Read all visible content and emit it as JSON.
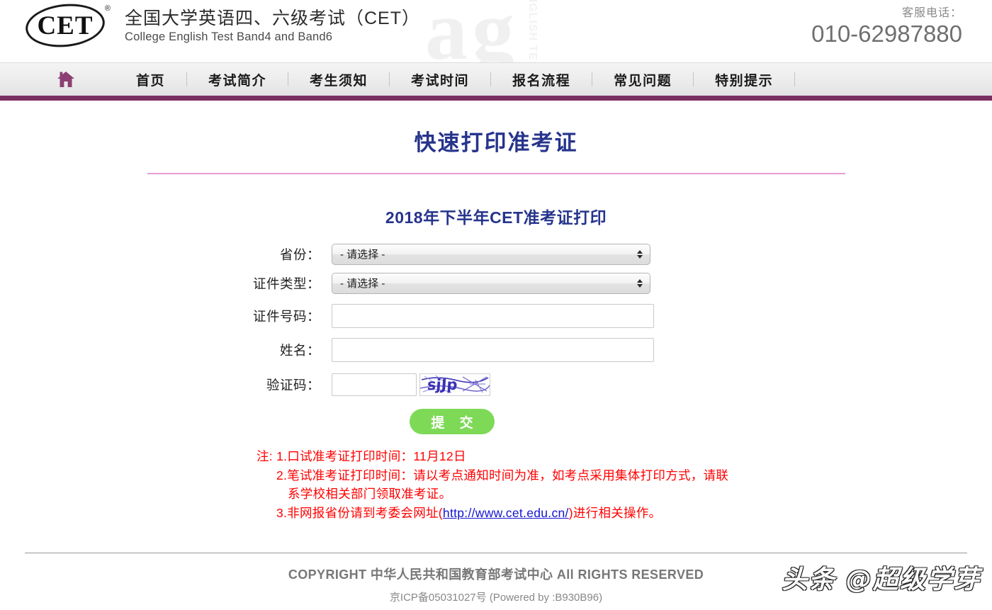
{
  "header": {
    "logo_text": "CET",
    "logo_reg": "®",
    "title_cn": "全国大学英语四、六级考试（CET）",
    "title_en": "College English Test Band4 and Band6",
    "service_label": "客服电话：",
    "service_phone": "010-62987880",
    "background_watermark": "ag",
    "background_watermark_rot": "ENGLISH TEST"
  },
  "nav": {
    "home_icon": "home-icon",
    "items": [
      {
        "label": "首页"
      },
      {
        "label": "考试简介"
      },
      {
        "label": "考生须知"
      },
      {
        "label": "考试时间"
      },
      {
        "label": "报名流程"
      },
      {
        "label": "常见问题"
      },
      {
        "label": "特别提示"
      }
    ],
    "accent_color": "#7b2f5f"
  },
  "main": {
    "page_title": "快速打印准考证",
    "title_rule_color": "#e79bd6",
    "form_heading": "2018年下半年CET准考证打印",
    "heading_color": "#26348c"
  },
  "form": {
    "province": {
      "label": "省份：",
      "value": "- 请选择 -",
      "options": [
        "- 请选择 -"
      ]
    },
    "id_type": {
      "label": "证件类型：",
      "value": "- 请选择 -",
      "options": [
        "- 请选择 -"
      ]
    },
    "id_number": {
      "label": "证件号码：",
      "value": "",
      "placeholder": ""
    },
    "name": {
      "label": "姓名：",
      "value": "",
      "placeholder": ""
    },
    "captcha": {
      "label": "验证码：",
      "value": "",
      "placeholder": "",
      "image_text": "sjJp"
    },
    "submit_label": "提 交",
    "submit_color": "#7ed957"
  },
  "notes": {
    "line1": "注: 1.口试准考证打印时间：11月12日",
    "line2": "2.笔试准考证打印时间：请以考点通知时间为准，如考点采用集体打印方式，请联",
    "line2b": "系学校相关部门领取准考证。",
    "line3_prefix": "3.非网报省份请到考委会网址(",
    "line3_link": "http://www.cet.edu.cn/",
    "line3_suffix": ")进行相关操作。",
    "color": "#ff0000",
    "link_color": "#1414d2"
  },
  "footer": {
    "copyright": "COPYRIGHT 中华人民共和国教育部考试中心 All RIGHTS RESERVED",
    "icp": "京ICP备05031027号 (Powered by :B930B96)",
    "watermark": "头条 @超级学芽"
  }
}
